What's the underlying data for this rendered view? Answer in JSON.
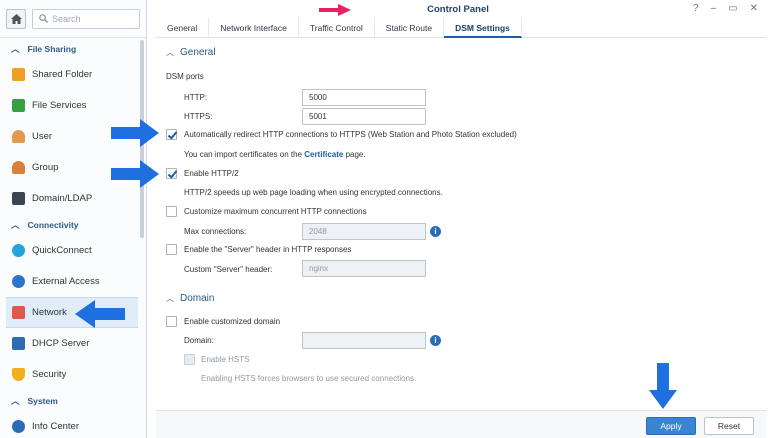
{
  "window": {
    "title": "Control Panel",
    "controls": [
      "?",
      "–",
      "▭",
      "✕"
    ]
  },
  "search": {
    "placeholder": "Search"
  },
  "sidebar": {
    "sections": [
      {
        "label": "File Sharing"
      },
      {
        "label": "Connectivity"
      },
      {
        "label": "System"
      }
    ],
    "items": [
      {
        "label": "Shared Folder"
      },
      {
        "label": "File Services"
      },
      {
        "label": "User"
      },
      {
        "label": "Group"
      },
      {
        "label": "Domain/LDAP"
      },
      {
        "label": "QuickConnect"
      },
      {
        "label": "External Access"
      },
      {
        "label": "Network"
      },
      {
        "label": "DHCP Server"
      },
      {
        "label": "Security"
      },
      {
        "label": "Info Center"
      }
    ]
  },
  "tabs": [
    "General",
    "Network Interface",
    "Traffic Control",
    "Static Route",
    "DSM Settings"
  ],
  "general": {
    "title": "General",
    "dsm_ports": "DSM ports",
    "http_label": "HTTP:",
    "http_value": "5000",
    "https_label": "HTTPS:",
    "https_value": "5001",
    "redirect_label": "Automatically redirect HTTP connections to HTTPS (Web Station and Photo Station excluded)",
    "cert_prefix": "You can import certificates on the ",
    "cert_link": "Certificate",
    "cert_suffix": " page.",
    "http2_label": "Enable HTTP/2",
    "http2_desc": "HTTP/2 speeds up web page loading when using encrypted connections.",
    "max_conn_cb": "Customize maximum concurrent HTTP connections",
    "max_conn_label": "Max connections:",
    "max_conn_value": "2048",
    "server_header_cb": "Enable the \"Server\" header in HTTP responses",
    "server_header_label": "Custom \"Server\" header:",
    "server_header_value": "nginx"
  },
  "domain": {
    "title": "Domain",
    "enable_label": "Enable customized domain",
    "domain_label": "Domain:",
    "hsts_label": "Enable HSTS",
    "hsts_desc": "Enabling HSTS forces browsers to use secured connections."
  },
  "footer": {
    "apply": "Apply",
    "reset": "Reset"
  },
  "colors": {
    "accent": "#1b5ea8",
    "arrow_blue": "#1e6fe0",
    "arrow_pink": "#e8215f"
  }
}
